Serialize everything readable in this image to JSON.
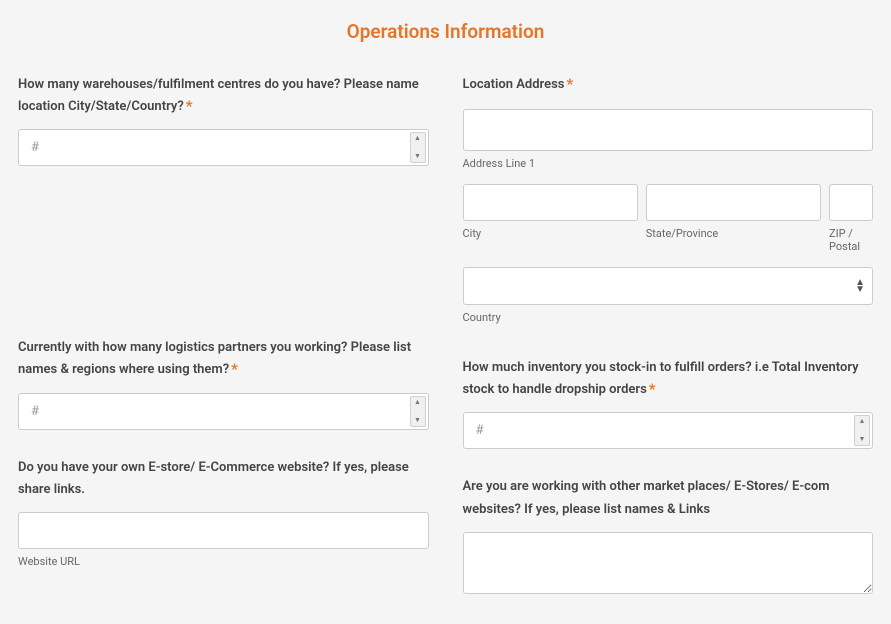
{
  "title": "Operations Information",
  "required_marker": "*",
  "fields": {
    "warehouses": {
      "label": "How many warehouses/fulfilment centres do you have? Please name location City/State/Country?",
      "placeholder": "#"
    },
    "location_address": {
      "label": "Location Address",
      "address1_sub": "Address Line 1",
      "city_sub": "City",
      "state_sub": "State/Province",
      "zip_sub": "ZIP / Postal",
      "country_sub": "Country"
    },
    "logistics": {
      "label": "Currently with how many logistics partners you working? Please list names & regions where using them?",
      "placeholder": "#"
    },
    "inventory": {
      "label": "How much inventory you stock-in to fulfill orders? i.e Total Inventory stock to handle dropship orders",
      "placeholder": "#"
    },
    "estore": {
      "label": "Do you have your own E-store/ E-Commerce website? If yes, please share links.",
      "sub": "Website URL"
    },
    "marketplaces": {
      "label": "Are you are working with other market places/ E-Stores/ E-com websites? If yes, please list names & Links"
    }
  }
}
